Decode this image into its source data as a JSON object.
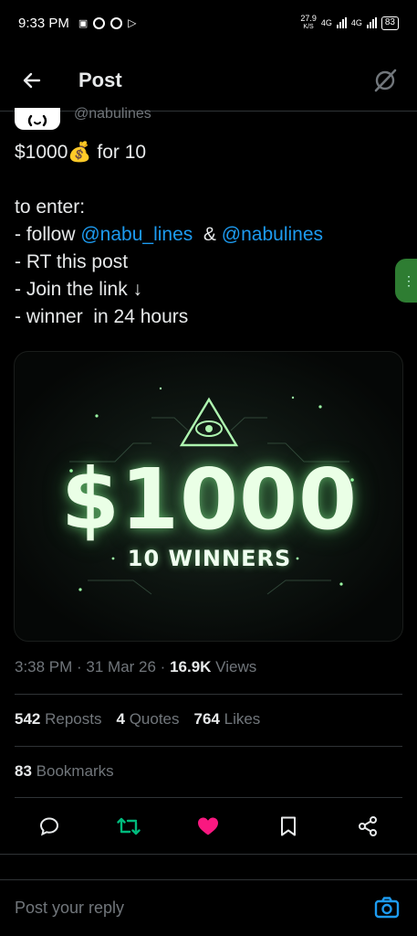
{
  "status": {
    "time": "9:33 PM",
    "speed_value": "27.9",
    "speed_unit": "K/S",
    "net1": "4G",
    "net2": "4G",
    "battery": "83"
  },
  "header": {
    "title": "Post"
  },
  "post": {
    "handle": "@nabulines",
    "line1_text": "$1000",
    "line1_emoji": "💰",
    "line1_rest": " for 10",
    "line3": "to enter:",
    "line4_prefix": "- follow ",
    "mention1": "@nabu_lines",
    "line4_mid": "  & ",
    "mention2": "@nabulines",
    "line5": "- RT this post",
    "line6": "- Join the link ↓",
    "line7": "- winner  in 24 hours"
  },
  "media": {
    "amount": "$1000",
    "winners": "10 WINNERS"
  },
  "meta": {
    "time": "3:38 PM · 31 Mar 26 · ",
    "views_count": "16.9K",
    "views_label": " Views"
  },
  "stats": {
    "reposts_count": "542",
    "reposts_label": "Reposts",
    "quotes_count": "4",
    "quotes_label": "Quotes",
    "likes_count": "764",
    "likes_label": "Likes",
    "bookmarks_count": "83",
    "bookmarks_label": "Bookmarks"
  },
  "reply": {
    "placeholder": "Post your reply"
  },
  "colors": {
    "accent": "#1d9bf0",
    "repost_active": "#00ba7c",
    "like_active": "#f91880",
    "side_tab": "#2e7d32"
  }
}
